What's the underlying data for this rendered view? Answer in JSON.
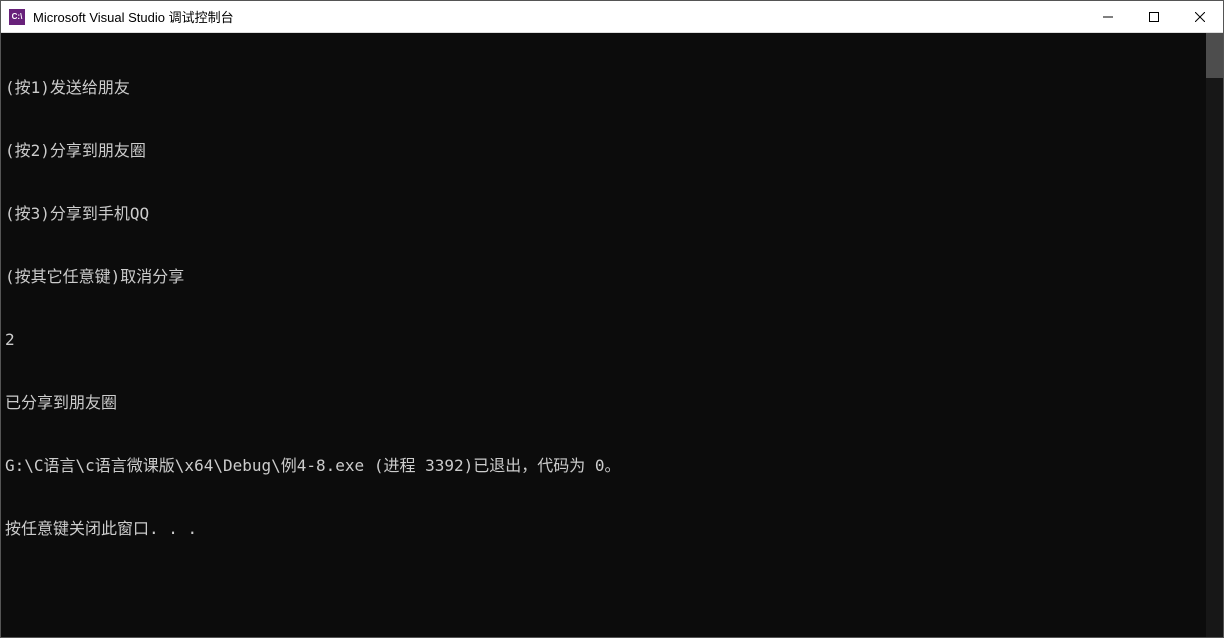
{
  "titlebar": {
    "icon_text": "C:\\",
    "title": "Microsoft Visual Studio 调试控制台"
  },
  "console": {
    "lines": [
      "(按1)发送给朋友",
      "(按2)分享到朋友圈",
      "(按3)分享到手机QQ",
      "(按其它任意键)取消分享",
      "2",
      "已分享到朋友圈",
      "G:\\C语言\\c语言微课版\\x64\\Debug\\例4-8.exe (进程 3392)已退出，代码为 0。",
      "按任意键关闭此窗口. . ."
    ]
  }
}
